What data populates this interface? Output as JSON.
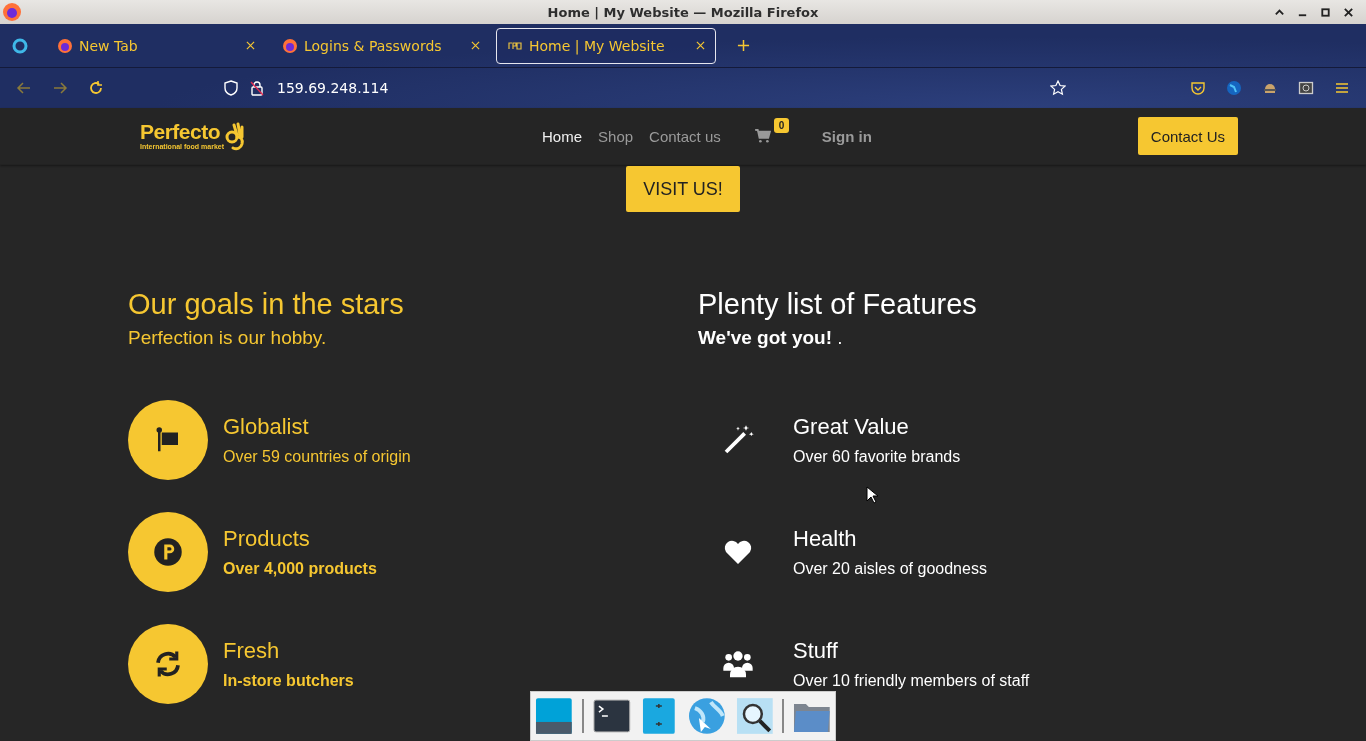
{
  "window": {
    "title": "Home | My Website — Mozilla Firefox"
  },
  "tabs": [
    {
      "label": "New Tab",
      "selected": false,
      "kind": "firefox"
    },
    {
      "label": "Logins & Passwords",
      "selected": false,
      "kind": "firefox"
    },
    {
      "label": "Home | My Website",
      "selected": true,
      "kind": "site"
    }
  ],
  "address_bar": {
    "value": "159.69.248.114"
  },
  "site": {
    "brand": "Perfecto",
    "tagline": "International food market",
    "nav": [
      {
        "label": "Home",
        "selected": true
      },
      {
        "label": "Shop",
        "selected": false
      },
      {
        "label": "Contact us",
        "selected": false
      }
    ],
    "cart_count": "0",
    "sign_in": "Sign in",
    "contact_button": "Contact Us",
    "visit_button": "VISIT US!"
  },
  "goals": {
    "title": "Our goals in the stars",
    "subtitle": "Perfection is our hobby.",
    "items": [
      {
        "kind": "flag",
        "title": "Globalist",
        "text": "Over 59 countries of origin",
        "bold": false
      },
      {
        "kind": "parking",
        "title": "Products",
        "text": "Over 4,000 products",
        "bold": true
      },
      {
        "kind": "refresh",
        "title": "Fresh",
        "text": "In-store butchers",
        "bold": true
      }
    ]
  },
  "features": {
    "title": "Plenty list of Features",
    "subtitle": "**We've got you!** .",
    "items": [
      {
        "kind": "wand",
        "title": "Great Value",
        "text": "Over 60 favorite brands"
      },
      {
        "kind": "heart",
        "title": "Health",
        "text": "Over 20 aisles of goodness"
      },
      {
        "kind": "users",
        "title": "Stuff",
        "text": "Over 10 friendly members of staff"
      }
    ]
  }
}
